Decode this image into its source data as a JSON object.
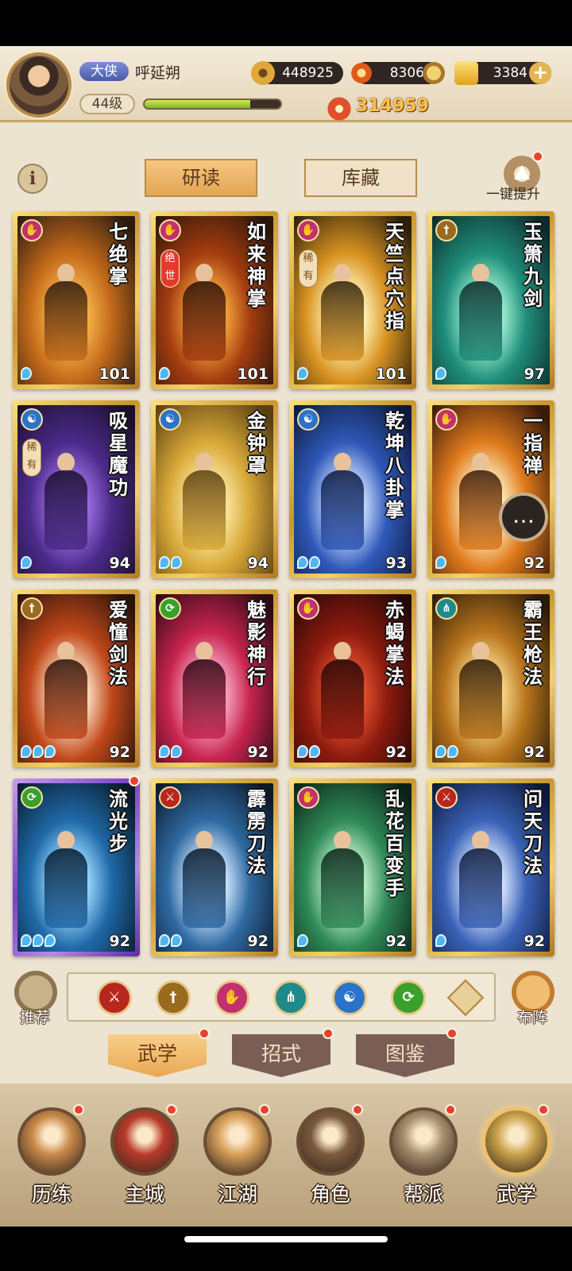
{
  "player": {
    "title_badge": "大侠",
    "name": "呼延朔",
    "level": "44级",
    "exp_fraction": 0.78
  },
  "resources": {
    "coins": "448925",
    "tokens": "8306",
    "gold": "3384",
    "power": "314959"
  },
  "top_tabs": {
    "read": "研读",
    "store": "库藏"
  },
  "onekey_label": "一键提升",
  "info_label": "i",
  "cards": [
    {
      "name": "七绝掌",
      "level": "101",
      "stars": 1,
      "school": "palm",
      "school_color": "#c2306f",
      "rarity": "",
      "art": [
        "#2a1a10",
        "#c46a1a",
        "#f6b44a"
      ],
      "frame": "gold"
    },
    {
      "name": "如来神掌",
      "level": "101",
      "stars": 1,
      "school": "palm",
      "school_color": "#c2306f",
      "rarity": "绝世",
      "art": [
        "#2b1409",
        "#a53d10",
        "#f5a33c"
      ],
      "frame": "gold"
    },
    {
      "name": "天竺点穴指",
      "level": "101",
      "stars": 1,
      "school": "palm",
      "school_color": "#c2306f",
      "rarity": "稀有",
      "art": [
        "#2d200a",
        "#d99322",
        "#fff4b8"
      ],
      "frame": "gold"
    },
    {
      "name": "玉箫九剑",
      "level": "97",
      "stars": 1,
      "school": "sword",
      "school_color": "#9a6a1f",
      "rarity": "",
      "art": [
        "#0d2b2a",
        "#1f8e7a",
        "#9ff0d2"
      ],
      "frame": "gold"
    },
    {
      "name": "吸星魔功",
      "level": "94",
      "stars": 1,
      "school": "internal",
      "school_color": "#2a73c9",
      "rarity": "稀有",
      "art": [
        "#1a0f2e",
        "#4b2a8a",
        "#9c6ee0"
      ],
      "frame": "gold"
    },
    {
      "name": "金钟罩",
      "level": "94",
      "stars": 2,
      "school": "internal",
      "school_color": "#2a73c9",
      "rarity": "",
      "art": [
        "#5a3f12",
        "#d8a838",
        "#fbe7a0"
      ],
      "frame": "gold"
    },
    {
      "name": "乾坤八卦掌",
      "level": "93",
      "stars": 2,
      "school": "internal",
      "school_color": "#2a73c9",
      "rarity": "",
      "art": [
        "#0d1a3e",
        "#2f58b8",
        "#c7dbff"
      ],
      "frame": "gold"
    },
    {
      "name": "一指禅",
      "level": "92",
      "stars": 1,
      "school": "palm",
      "school_color": "#c2306f",
      "rarity": "",
      "art": [
        "#3a1a08",
        "#e07b1d",
        "#fff0c2"
      ],
      "frame": "gold"
    },
    {
      "name": "爱憧剑法",
      "level": "92",
      "stars": 3,
      "school": "sword",
      "school_color": "#9a6a1f",
      "rarity": "",
      "art": [
        "#2b1208",
        "#c1481a",
        "#fbe0c2"
      ],
      "frame": "gold"
    },
    {
      "name": "魅影神行",
      "level": "92",
      "stars": 2,
      "school": "movement",
      "school_color": "#3ba02b",
      "rarity": "",
      "art": [
        "#2a0814",
        "#c8244e",
        "#f7a8c4"
      ],
      "frame": "gold"
    },
    {
      "name": "赤蝎掌法",
      "level": "92",
      "stars": 2,
      "school": "palm",
      "school_color": "#c2306f",
      "rarity": "",
      "art": [
        "#240806",
        "#8c1a0e",
        "#e0502c"
      ],
      "frame": "gold"
    },
    {
      "name": "霸王枪法",
      "level": "92",
      "stars": 2,
      "school": "spear",
      "school_color": "#1f8a8a",
      "rarity": "",
      "art": [
        "#2a1a08",
        "#b8741c",
        "#f8d88a"
      ],
      "frame": "gold"
    },
    {
      "name": "流光步",
      "level": "92",
      "stars": 3,
      "school": "movement",
      "school_color": "#3ba02b",
      "rarity": "",
      "art": [
        "#081a2a",
        "#1f6aa8",
        "#9cd8ff"
      ],
      "frame": "purple"
    },
    {
      "name": "霹雳刀法",
      "level": "92",
      "stars": 2,
      "school": "blade",
      "school_color": "#b8261e",
      "rarity": "",
      "art": [
        "#0a1828",
        "#2f6aa2",
        "#cfe8ff"
      ],
      "frame": "gold"
    },
    {
      "name": "乱花百变手",
      "level": "92",
      "stars": 1,
      "school": "palm",
      "school_color": "#c2306f",
      "rarity": "",
      "art": [
        "#0a2218",
        "#2f8a58",
        "#bff0c8"
      ],
      "frame": "gold"
    },
    {
      "name": "问天刀法",
      "level": "92",
      "stars": 1,
      "school": "blade",
      "school_color": "#b8261e",
      "rarity": "",
      "art": [
        "#0c1a38",
        "#3a62b8",
        "#dbe8ff"
      ],
      "frame": "gold"
    }
  ],
  "filter": {
    "recommend_label": "推荐",
    "formation_label": "布阵",
    "schools": [
      {
        "id": "blade",
        "color": "#b8261e"
      },
      {
        "id": "sword",
        "color": "#9a6a1f"
      },
      {
        "id": "palm",
        "color": "#c2306f"
      },
      {
        "id": "spear",
        "color": "#1f8a8a"
      },
      {
        "id": "internal",
        "color": "#2a73c9"
      },
      {
        "id": "movement",
        "color": "#3ba02b"
      }
    ]
  },
  "subtabs": {
    "martial": "武学",
    "moves": "招式",
    "codex": "图鉴"
  },
  "nav": [
    {
      "label": "历练",
      "color": "#c98a4a"
    },
    {
      "label": "主城",
      "color": "#b83a2a"
    },
    {
      "label": "江湖",
      "color": "#d8a05a"
    },
    {
      "label": "角色",
      "color": "#7a5a3e"
    },
    {
      "label": "帮派",
      "color": "#a89070"
    },
    {
      "label": "武学",
      "color": "#c9a24a"
    }
  ]
}
